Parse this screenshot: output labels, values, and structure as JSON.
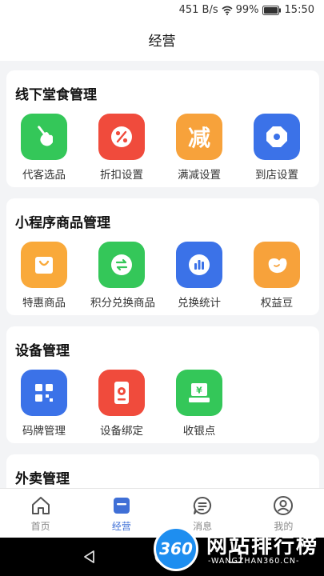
{
  "status_bar": {
    "speed": "451 B/s",
    "battery": "99%",
    "time": "15:50"
  },
  "page": {
    "title": "经营"
  },
  "sections": [
    {
      "title": "线下堂食管理",
      "items": [
        {
          "label": "代客选品",
          "icon": "hand-pointer-icon",
          "color": "#34c759"
        },
        {
          "label": "折扣设置",
          "icon": "percent-icon",
          "color": "#f04b3c"
        },
        {
          "label": "满减设置",
          "icon": "jian-glyph-icon",
          "glyph": "减",
          "color": "#f7a23b"
        },
        {
          "label": "到店设置",
          "icon": "store-octagon-icon",
          "color": "#3b72e8"
        }
      ]
    },
    {
      "title": "小程序商品管理",
      "items": [
        {
          "label": "特惠商品",
          "icon": "shopping-bag-icon",
          "color": "#f9a93a"
        },
        {
          "label": "积分兑换商品",
          "icon": "exchange-icon",
          "color": "#34c759"
        },
        {
          "label": "兑换统计",
          "icon": "bar-chart-icon",
          "color": "#3b72e8"
        },
        {
          "label": "权益豆",
          "icon": "bean-icon",
          "color": "#f7a23b"
        }
      ]
    },
    {
      "title": "设备管理",
      "items": [
        {
          "label": "码牌管理",
          "icon": "qr-code-icon",
          "color": "#3b72e8"
        },
        {
          "label": "设备绑定",
          "icon": "device-icon",
          "color": "#f04b3c"
        },
        {
          "label": "收银点",
          "icon": "cashier-icon",
          "color": "#34c759"
        }
      ]
    },
    {
      "title": "外卖管理",
      "items": []
    }
  ],
  "tabbar": [
    {
      "label": "首页",
      "icon": "home-icon",
      "active": false
    },
    {
      "label": "经营",
      "icon": "business-icon",
      "active": true
    },
    {
      "label": "消息",
      "icon": "message-icon",
      "active": false
    },
    {
      "label": "我的",
      "icon": "profile-icon",
      "active": false
    }
  ],
  "watermark": {
    "logo": "360",
    "title": "网站排行榜",
    "subtitle": "-WANGZHAN360.CN-"
  },
  "colors": {
    "accent": "#3f6fd6",
    "background": "#f3f4f6"
  }
}
